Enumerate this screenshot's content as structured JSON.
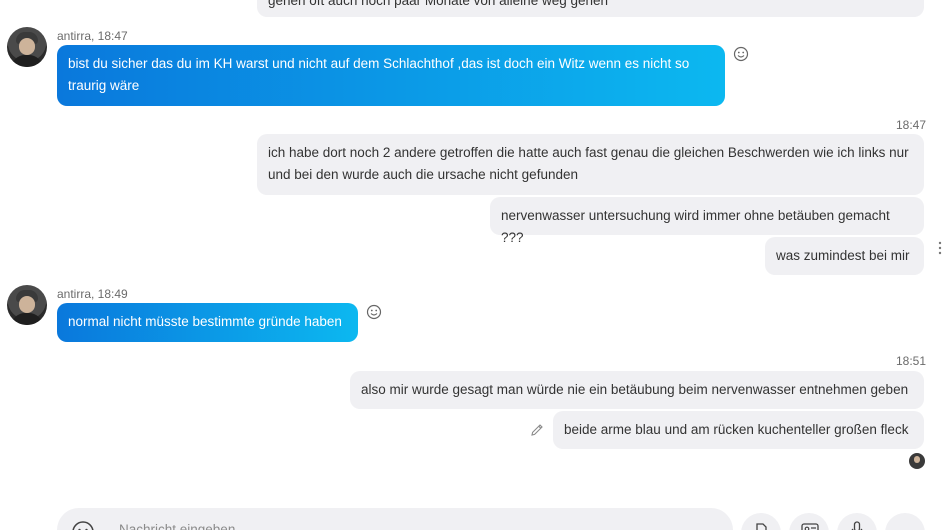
{
  "messages": {
    "top_partial": "gehen oft auch noch paar Monate von alleine weg gehen",
    "group1": {
      "sender_meta": "antirra, 18:47",
      "text": "bist du sicher das du im KH warst und nicht auf dem Schlachthof ,das ist doch ein Witz wenn es nicht so traurig wäre"
    },
    "group2": {
      "time": "18:47",
      "msg1": "ich habe dort noch 2 andere getroffen die hatte auch fast genau die gleichen Beschwerden wie ich links nur und bei den wurde auch die ursache nicht gefunden",
      "msg2": "nervenwasser untersuchung wird immer ohne betäuben gemacht ???",
      "msg3": "was zumindest bei mir"
    },
    "group3": {
      "sender_meta": "antirra, 18:49",
      "text": "normal nicht müsste bestimmte gründe haben"
    },
    "group4": {
      "time": "18:51",
      "msg1": "also mir wurde gesagt man würde nie ein betäubung beim nervenwasser entnehmen geben",
      "msg2": "beide arme blau und am rücken kuchenteller großen fleck"
    }
  },
  "composer": {
    "placeholder": "Nachricht eingeben"
  },
  "icons": {
    "emoji": "smiley-icon",
    "edit": "pencil-icon",
    "more": "more-vertical-icon",
    "attach": "attach-file-icon",
    "contact": "contact-card-icon",
    "mic": "microphone-icon"
  },
  "colors": {
    "incoming_start": "#0a78dc",
    "incoming_end": "#0cb8f0",
    "outgoing_bg": "#f0f0f3"
  }
}
